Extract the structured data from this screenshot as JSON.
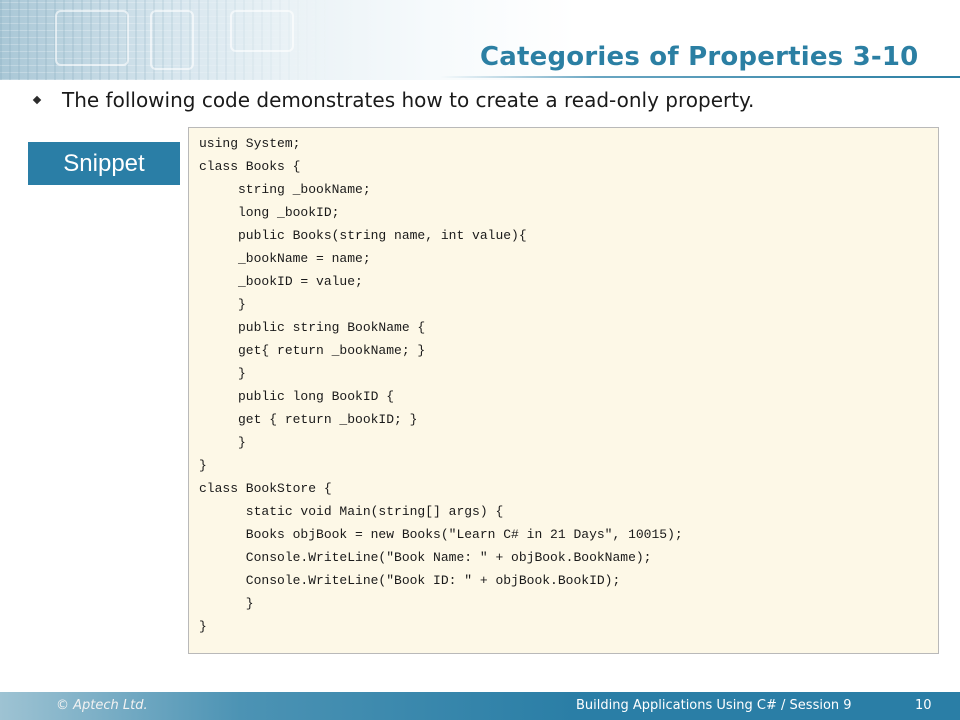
{
  "slide": {
    "title": "Categories of Properties 3-10",
    "bullet": "The following code demonstrates how to create a read-only property.",
    "snippet_label": "Snippet"
  },
  "code": {
    "lines": [
      "using System;",
      "class Books {",
      "     string _bookName;",
      "     long _bookID;",
      "     public Books(string name, int value){",
      "     _bookName = name;",
      "     _bookID = value;",
      "     }",
      "     public string BookName {",
      "     get{ return _bookName; }",
      "     }",
      "     public long BookID {",
      "     get { return _bookID; }",
      "     }",
      "}",
      "class BookStore {",
      "      static void Main(string[] args) {",
      "      Books objBook = new Books(\"Learn C# in 21 Days\", 10015);",
      "      Console.WriteLine(\"Book Name: \" + objBook.BookName);",
      "      Console.WriteLine(\"Book ID: \" + objBook.BookID);",
      "      }",
      "}"
    ]
  },
  "footer": {
    "copyright": "© Aptech Ltd.",
    "session": "Building Applications Using C# / Session 9",
    "page": "10"
  },
  "icons": {
    "bullet": "diamond-bullet-icon"
  },
  "colors": {
    "accent": "#2a7ea6",
    "title": "#2b7fa3",
    "code_bg": "#fdf8e7"
  }
}
